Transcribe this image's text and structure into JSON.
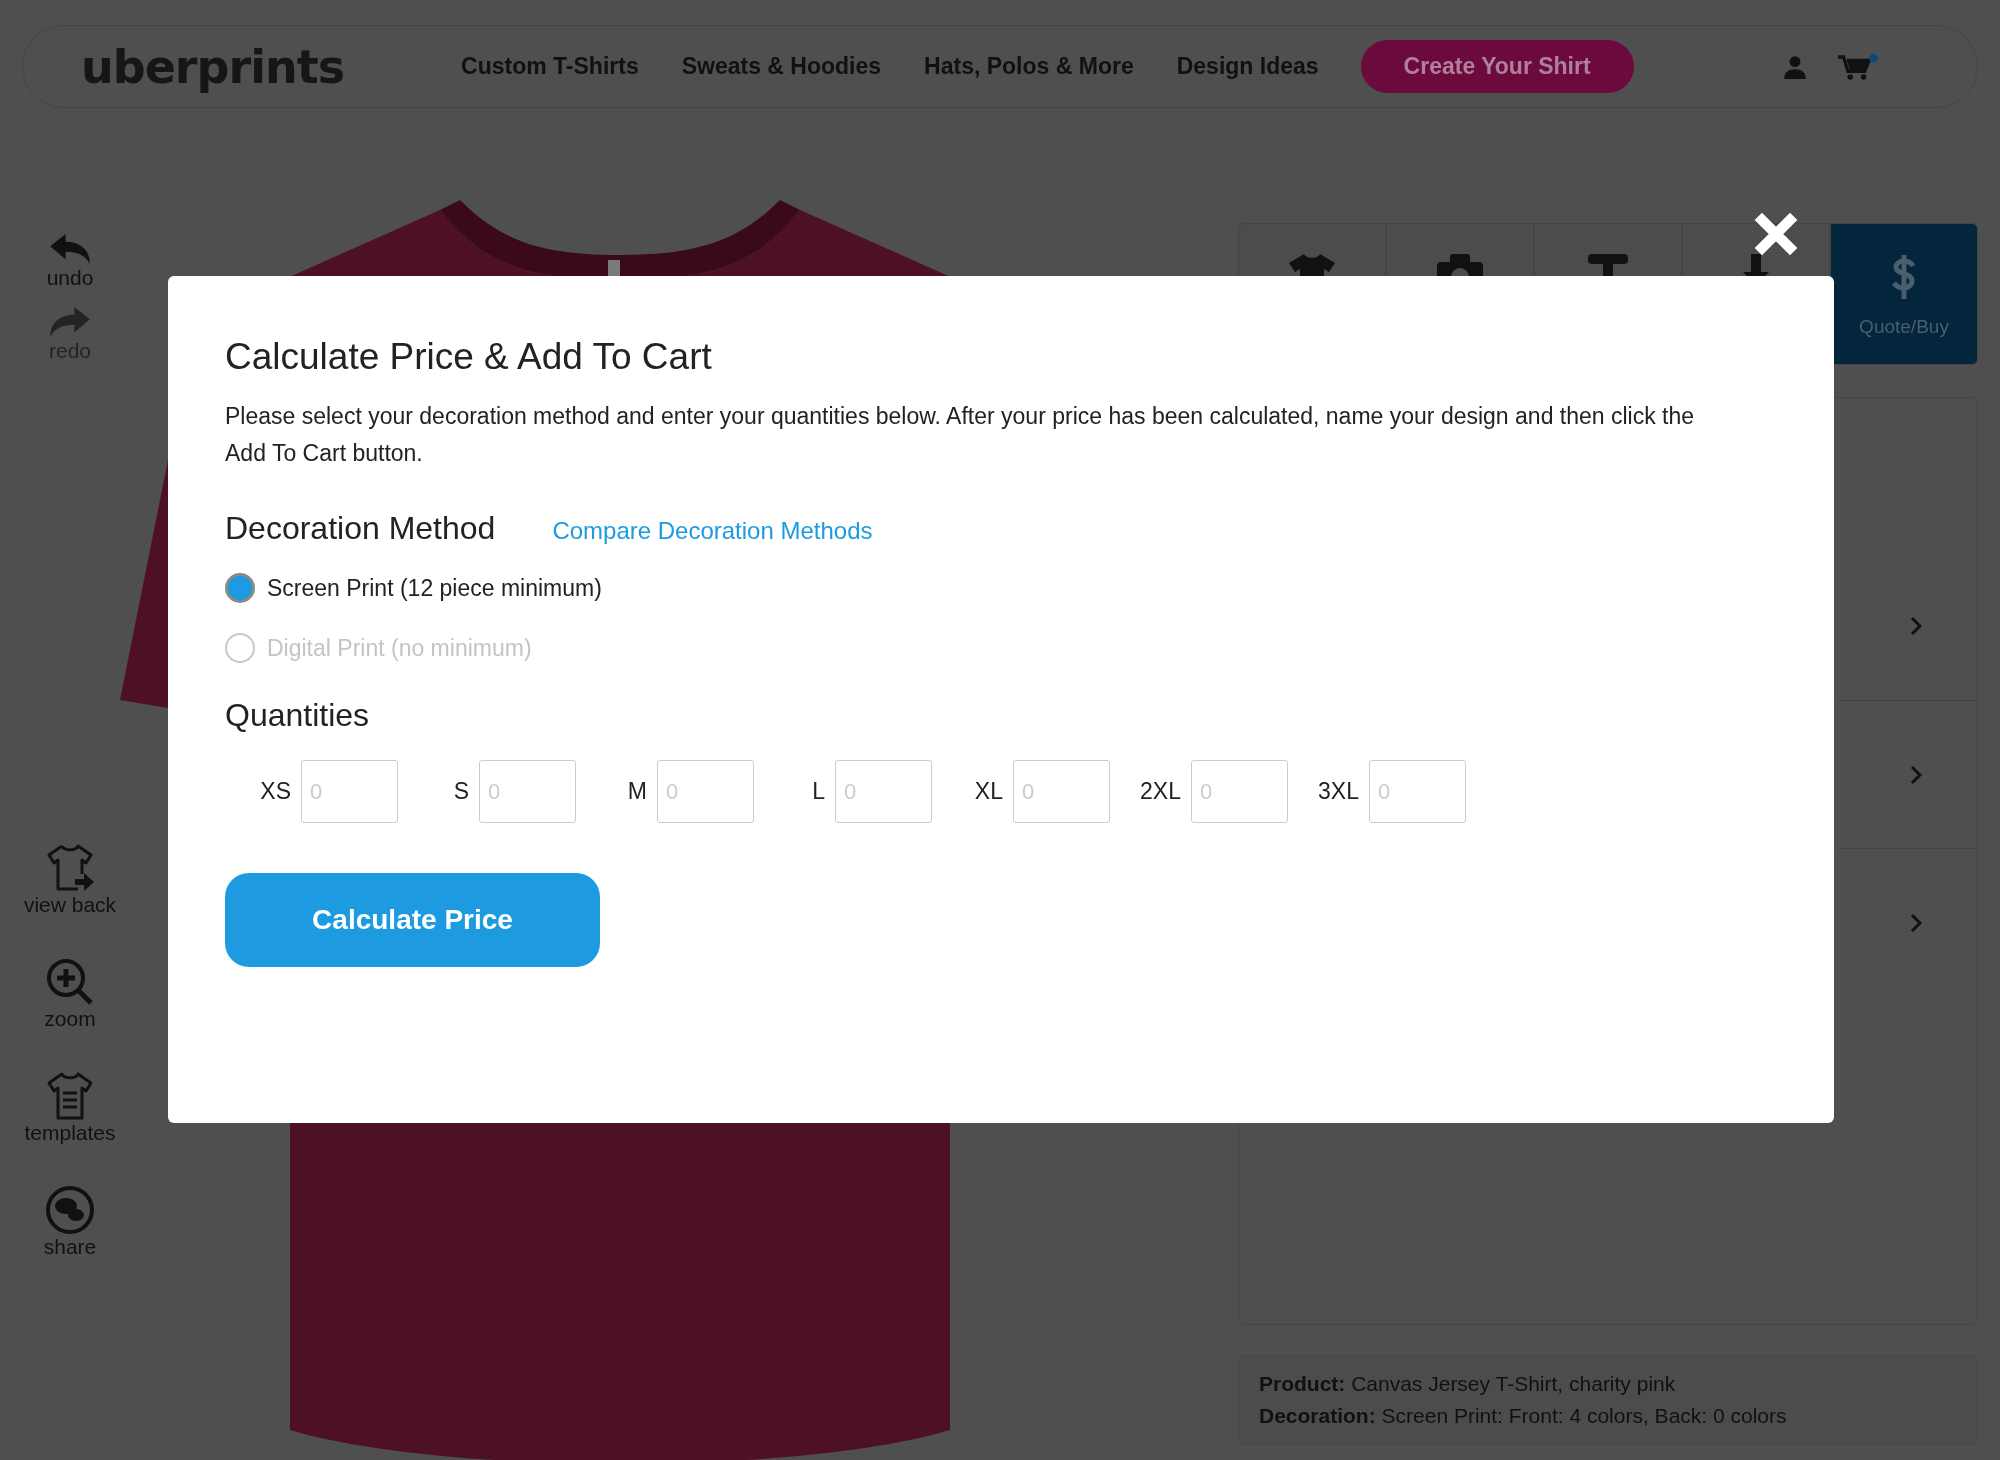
{
  "header": {
    "logo": "uberprints",
    "nav": [
      "Custom T-Shirts",
      "Sweats & Hoodies",
      "Hats, Polos & More",
      "Design Ideas"
    ],
    "cta": "Create Your Shirt"
  },
  "history_tools": [
    {
      "kind": "undo",
      "label": "undo",
      "disabled": false
    },
    {
      "kind": "redo",
      "label": "redo",
      "disabled": true
    }
  ],
  "view_tools": [
    {
      "kind": "view-back",
      "label": "view back"
    },
    {
      "kind": "zoom",
      "label": "zoom"
    },
    {
      "kind": "templates",
      "label": "templates"
    },
    {
      "kind": "share",
      "label": "share"
    }
  ],
  "design_tabs": [
    {
      "kind": "shirt",
      "selected": false
    },
    {
      "kind": "camera",
      "selected": false
    },
    {
      "kind": "text",
      "selected": false
    },
    {
      "kind": "download",
      "selected": false
    },
    {
      "kind": "quote",
      "label": "Quote/Buy",
      "selected": true
    }
  ],
  "summary": [
    "**Product:** Canvas Jersey T-Shirt, charity pink",
    "**Decoration:** Screen Print: Front: 4 colors, Back: 0 colors"
  ],
  "modal": {
    "title": "Calculate Price & Add To Cart",
    "intro": "Please select your decoration method and enter your quantities below. After your price has been calculated, name your design and then click the Add To Cart button.",
    "method_heading": "Decoration Method",
    "compare_link": "Compare Decoration Methods",
    "methods": [
      {
        "label": "Screen Print (12 piece minimum)",
        "selected": true,
        "disabled": false
      },
      {
        "label": "Digital Print (no minimum)",
        "selected": false,
        "disabled": true
      }
    ],
    "quantities_heading": "Quantities",
    "sizes": [
      {
        "label": "XS",
        "placeholder": "0"
      },
      {
        "label": "S",
        "placeholder": "0"
      },
      {
        "label": "M",
        "placeholder": "0"
      },
      {
        "label": "L",
        "placeholder": "0"
      },
      {
        "label": "XL",
        "placeholder": "0"
      },
      {
        "label": "2XL",
        "placeholder": "0"
      },
      {
        "label": "3XL",
        "placeholder": "0"
      }
    ],
    "button": "Calculate Price"
  }
}
